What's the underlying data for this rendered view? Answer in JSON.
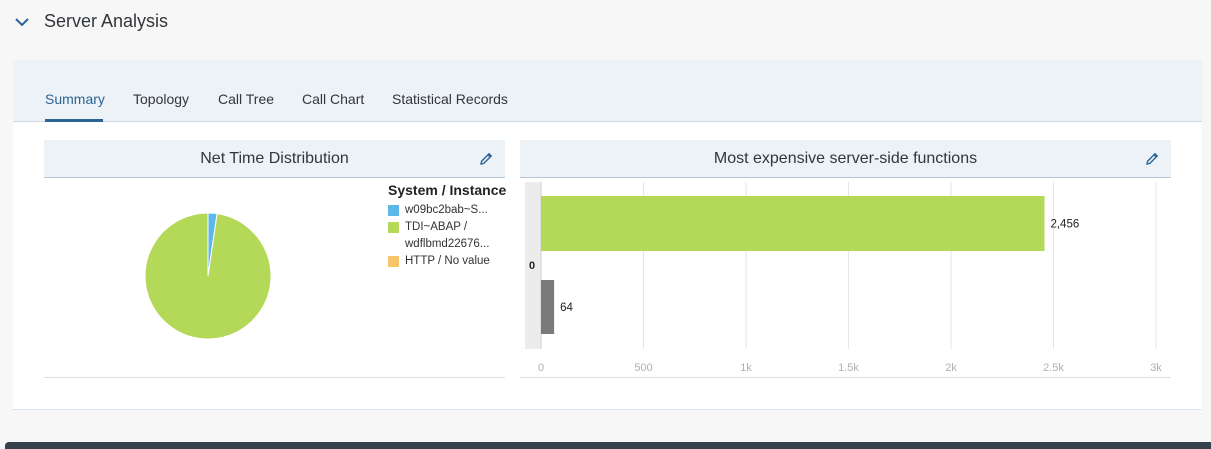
{
  "section": {
    "title": "Server Analysis",
    "collapse_icon": "chevron-down-icon"
  },
  "tabs": [
    {
      "label": "Summary",
      "active": true
    },
    {
      "label": "Topology",
      "active": false
    },
    {
      "label": "Call Tree",
      "active": false
    },
    {
      "label": "Call Chart",
      "active": false
    },
    {
      "label": "Statistical Records",
      "active": false
    }
  ],
  "net_time_card": {
    "title": "Net Time Distribution",
    "edit_icon": "pencil-icon",
    "legend_title": "System / Instance",
    "legend": [
      {
        "label": "w09bc2bab~S...",
        "color": "#5bb8e8"
      },
      {
        "label": "TDI~ABAP / wdflbmd22676...",
        "color": "#b4d857"
      },
      {
        "label": "HTTP / No value",
        "color": "#f6c46a"
      }
    ]
  },
  "expensive_card": {
    "title": "Most expensive server-side functions",
    "edit_icon": "pencil-icon"
  },
  "chart_data": [
    {
      "type": "pie",
      "title": "Net Time Distribution",
      "legend_title": "System / Instance",
      "labels": [
        "w09bc2bab~S...",
        "TDI~ABAP / wdflbmd22676...",
        "HTTP / No value"
      ],
      "values": [
        2.3,
        97.7,
        0
      ],
      "colors": [
        "#5bb8e8",
        "#b4d857",
        "#f6c46a"
      ]
    },
    {
      "type": "bar",
      "orientation": "horizontal",
      "title": "Most expensive server-side functions",
      "categories": [
        "0",
        ""
      ],
      "values": [
        2456,
        64
      ],
      "value_labels": [
        "2,456",
        "64"
      ],
      "colors": [
        "#b4d857",
        "#7a7a7a"
      ],
      "xlim": [
        0,
        3000
      ],
      "xticks": [
        0,
        500,
        1000,
        1500,
        2000,
        2500,
        3000
      ],
      "xtick_labels": [
        "0",
        "500",
        "1k",
        "1.5k",
        "2k",
        "2.5k",
        "3k"
      ],
      "grid": true
    }
  ],
  "colors": {
    "accent": "#2a6496",
    "header_bg": "#edf2f7",
    "footer_bar": "#34424e"
  }
}
